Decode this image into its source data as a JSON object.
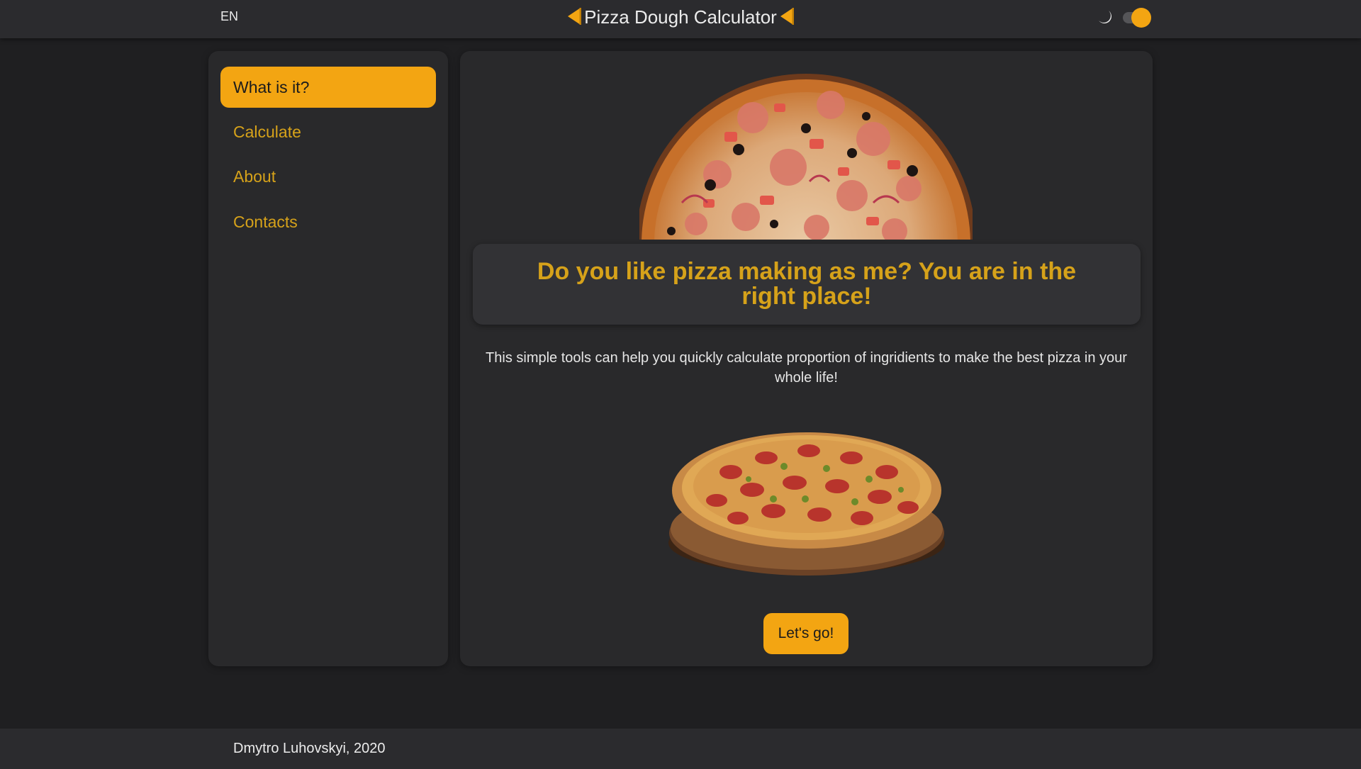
{
  "header": {
    "language": "EN",
    "title": "Pizza Dough Calculator",
    "left_icon": "pizza-slice-icon",
    "right_icon": "pizza-slice-icon",
    "theme_icon": "moon-icon",
    "theme_toggle_on": true
  },
  "sidebar": {
    "items": [
      {
        "label": "What is it?",
        "active": true
      },
      {
        "label": "Calculate",
        "active": false
      },
      {
        "label": "About",
        "active": false
      },
      {
        "label": "Contacts",
        "active": false
      }
    ]
  },
  "main": {
    "headline": "Do you like pizza making as me? You are in the right place!",
    "description": "This simple tools can help you quickly calculate proportion of ingridients to make the best pizza in your whole life!",
    "cta_label": "Let's go!"
  },
  "footer": {
    "text": "Dmytro Luhovskyi, 2020"
  },
  "colors": {
    "accent": "#f3a512",
    "accent_text": "#d6a21a",
    "page_background": "#1f1f21",
    "panel_background": "#29292b",
    "bar_background": "#2b2b2e"
  }
}
